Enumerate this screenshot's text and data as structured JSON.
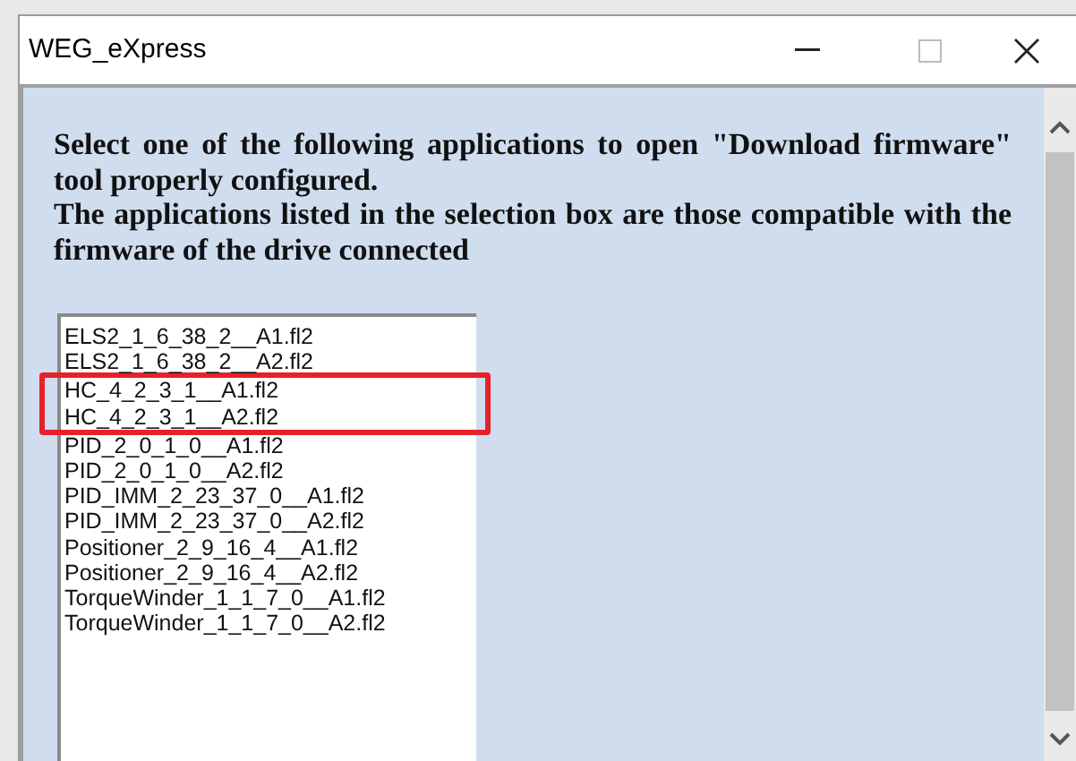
{
  "window": {
    "title": "WEG_eXpress"
  },
  "instructions": [
    "Select one of the following applications to open \"Download firmware\" tool properly configured.",
    "The applications listed in the selection box are those compatible with the firmware of the drive connected"
  ],
  "application_list": {
    "items_above": [
      "ELS2_1_6_38_2__A1.fl2",
      "ELS2_1_6_38_2__A2.fl2"
    ],
    "highlighted_items": [
      "HC_4_2_3_1__A1.fl2",
      "HC_4_2_3_1__A2.fl2"
    ],
    "items_below": [
      "PID_2_0_1_0__A1.fl2",
      "PID_2_0_1_0__A2.fl2",
      "PID_IMM_2_23_37_0__A1.fl2",
      "PID_IMM_2_23_37_0__A2.fl2",
      "Positioner_2_9_16_4__A1.fl2",
      "Positioner_2_9_16_4__A2.fl2",
      "TorqueWinder_1_1_7_0__A1.fl2",
      "TorqueWinder_1_1_7_0__A2.fl2"
    ]
  }
}
